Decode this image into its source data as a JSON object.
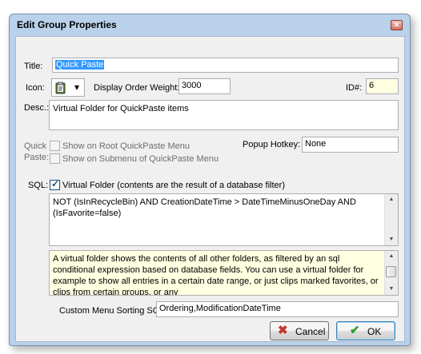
{
  "window": {
    "title": "Edit Group Properties",
    "close_glyph": "✕"
  },
  "title_field": {
    "label": "Title:",
    "value": "Quick Paste"
  },
  "icon": {
    "label": "Icon:",
    "icon_name": "clipboard-icon",
    "dropdown": "▾"
  },
  "display_order": {
    "label": "Display Order Weight:",
    "value": "3000"
  },
  "id": {
    "label": "ID#:",
    "value": "6"
  },
  "desc": {
    "label": "Desc.:",
    "value": "Virtual Folder for QuickPaste items"
  },
  "quick_paste": {
    "label_line1": "Quick",
    "label_line2": "Paste:",
    "show_root": {
      "label": "Show on Root QuickPaste Menu",
      "checked": false
    },
    "show_submenu": {
      "label": "Show on Submenu of QuickPaste Menu",
      "checked": false
    }
  },
  "popup_hotkey": {
    "label": "Popup Hotkey:",
    "value": "None"
  },
  "sql": {
    "label": "SQL:",
    "virtual_folder_label": "Virtual Folder (contents are the result of a database filter)",
    "virtual_folder_checked": true,
    "query": "NOT (IsInRecycleBin) AND CreationDateTime > DateTimeMinusOneDay AND (IsFavorite=false)"
  },
  "help_text": "A virtual folder shows the contents of all other folders, as filtered by an sql conditional expression based on database fields.  You can use a virtual folder for example to show all entries in a certain date range, or just clips marked favorites, or clips from certain groups, or any",
  "custom_sort": {
    "label": "Custom Menu Sorting SQL:",
    "value": "Ordering,ModificationDateTime"
  },
  "buttons": {
    "cancel": "Cancel",
    "ok": "OK"
  },
  "colors": {
    "selection": "#3399ff",
    "help_bg": "#ffffe1",
    "cancel_icon": "#c0392b",
    "ok_icon": "#2e9e2e"
  }
}
